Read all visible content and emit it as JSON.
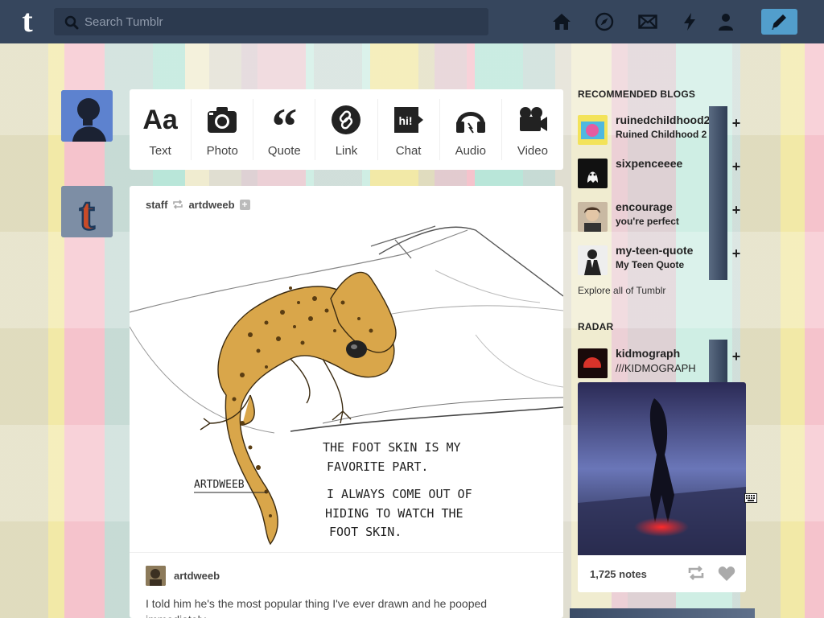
{
  "header": {
    "search_placeholder": "Search Tumblr",
    "icons": [
      "home-icon",
      "explore-icon",
      "inbox-icon",
      "activity-icon",
      "account-icon"
    ],
    "compose_icon": "pencil-icon"
  },
  "post_types": [
    {
      "label": "Text",
      "icon": "text-icon"
    },
    {
      "label": "Photo",
      "icon": "camera-icon"
    },
    {
      "label": "Quote",
      "icon": "quote-icon"
    },
    {
      "label": "Link",
      "icon": "link-icon"
    },
    {
      "label": "Chat",
      "icon": "chat-icon"
    },
    {
      "label": "Audio",
      "icon": "headphones-icon"
    },
    {
      "label": "Video",
      "icon": "video-camera-icon"
    }
  ],
  "post": {
    "reblogger": "staff",
    "source": "artdweeb",
    "art": {
      "signature": "ARTDWEEB",
      "line1": "THE  FOOT  SKIN  IS  MY",
      "line2": "FAVORITE  PART.",
      "line3": "I  ALWAYS  COME  OUT  OF",
      "line4": "HIDING  TO  WATCH  THE",
      "line5": "FOOT  SKIN."
    },
    "caption_author": "artdweeb",
    "caption_text": "I told him he's the most popular thing I've ever drawn and he pooped immediately."
  },
  "sidebar": {
    "recommended_title": "RECOMMENDED BLOGS",
    "blogs": [
      {
        "name": "ruinedchildhood2",
        "sub": "Ruined Childhood 2"
      },
      {
        "name": "sixpenceeee",
        "sub": ""
      },
      {
        "name": "encourage",
        "sub": "you're perfect"
      },
      {
        "name": "my-teen-quote",
        "sub": "My Teen Quote"
      }
    ],
    "follow_symbol": "+",
    "explore_label": "Explore all of Tumblr",
    "radar_title": "RADAR",
    "radar": {
      "name": "kidmograph",
      "sub": "///KIDMOGRAPH",
      "notes": "1,725 notes"
    }
  },
  "colors": {
    "header_bg": "#36465d",
    "compose_bg": "#529ecc",
    "gecko": "#d9a64a"
  }
}
